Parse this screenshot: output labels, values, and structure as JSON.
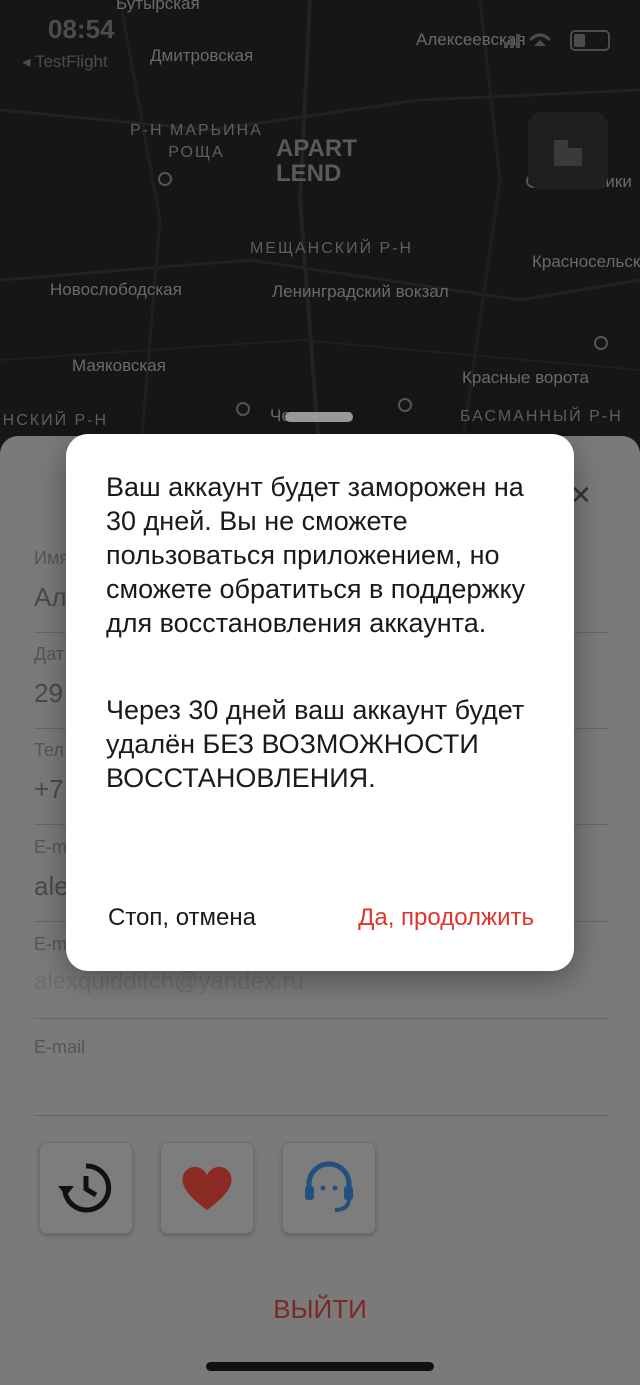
{
  "status": {
    "time": "08:54",
    "back_label": "◂ TestFlight"
  },
  "map": {
    "logo_line1": "APART",
    "logo_line2": "LEND",
    "labels": [
      "Бутырская",
      "Дмитровская",
      "Алексеевская",
      "Новослободская",
      "Ленинградский вокзал",
      "Красносельская",
      "Маяковская",
      "Красные ворота",
      "Чеховская",
      "ники"
    ],
    "districts": [
      "Р-Н МАРЬИНА\nРОЩА",
      "МЕЩАНСКИЙ Р-Н",
      "БАСМАННЫЙ Р-Н",
      "ЕНСКИЙ Р-Н"
    ]
  },
  "profile": {
    "close_icon": "close-icon",
    "fields": [
      {
        "label": "Имя",
        "value": "Ал"
      },
      {
        "label": "Дат",
        "value": "29"
      },
      {
        "label": "Тел",
        "value": "+7"
      },
      {
        "label": "E-m",
        "value": "ale"
      },
      {
        "label": "E-m",
        "value": "alexquidditch@yandex.ru"
      },
      {
        "label": "E-mail",
        "value": ""
      }
    ],
    "actions": [
      {
        "icon": "history-icon"
      },
      {
        "icon": "heart-icon"
      },
      {
        "icon": "support-headset-icon"
      }
    ],
    "logout_label": "ВЫЙТИ"
  },
  "dialog": {
    "text1": "Ваш аккаунт будет заморожен на 30 дней. Вы не сможете пользоваться приложением, но сможете обратиться в поддержку для восстановления аккаунта.",
    "text2": "Через 30 дней ваш аккаунт будет удалён БЕЗ ВОЗМОЖНОСТИ ВОССТАНОВЛЕНИЯ.",
    "cancel_label": "Стоп, отмена",
    "confirm_label": "Да, продолжить"
  },
  "colors": {
    "accent": "#e0352b",
    "heart": "#d0312d",
    "support": "#2a73c9"
  }
}
